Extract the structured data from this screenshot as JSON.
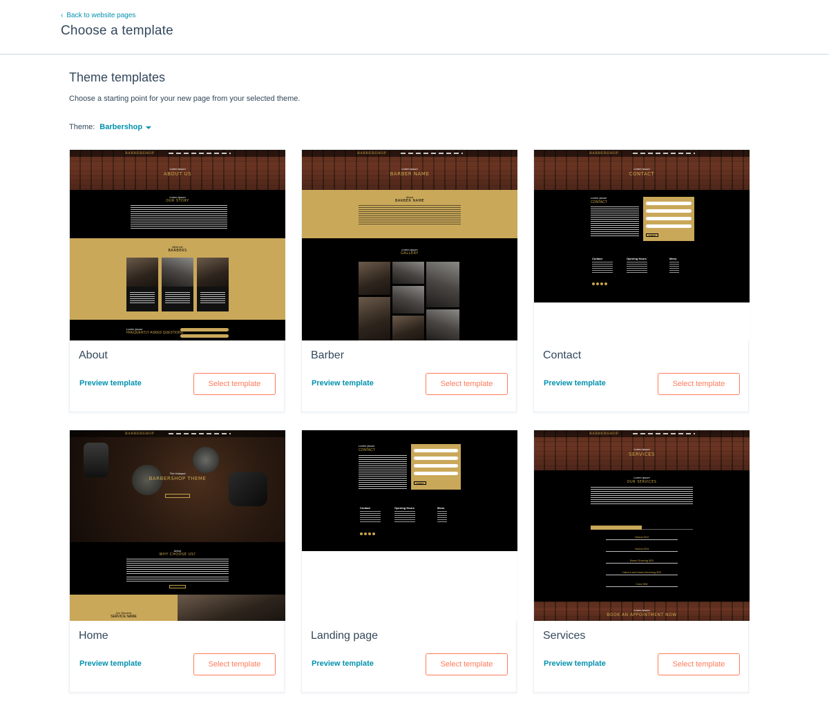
{
  "header": {
    "back_label": "Back to website pages",
    "title": "Choose a template"
  },
  "main": {
    "section_title": "Theme templates",
    "section_desc": "Choose a starting point for your new page from your selected theme.",
    "theme_label": "Theme:",
    "theme_value": "Barbershop"
  },
  "templates": [
    {
      "name": "About",
      "preview_label": "Preview template",
      "select_label": "Select template"
    },
    {
      "name": "Barber",
      "preview_label": "Preview template",
      "select_label": "Select template"
    },
    {
      "name": "Contact",
      "preview_label": "Preview template",
      "select_label": "Select template"
    },
    {
      "name": "Home",
      "preview_label": "Preview template",
      "select_label": "Select template"
    },
    {
      "name": "Landing page",
      "preview_label": "Preview template",
      "select_label": "Select template"
    },
    {
      "name": "Services",
      "preview_label": "Preview template",
      "select_label": "Select template"
    }
  ],
  "thumbs": {
    "logo": "BARBERSHOP",
    "about": {
      "hero": "ABOUT US",
      "story": "OUR STORY",
      "barbers": "BARBERS",
      "faq": "FREQUENTLY ASKED QUESTIONS",
      "kicker": "Lorem Ipsum",
      "kicker2": "Meet the"
    },
    "barber": {
      "hero": "BARBER NAME",
      "about": "BARBER NAME",
      "gallery": "GALLERY",
      "kicker": "Lorem Ipsum",
      "kicker2": "About"
    },
    "contact": {
      "hero": "CONTACT",
      "contact": "CONTACT",
      "kicker": "Lorem Ipsum",
      "col1": "Contact",
      "col2": "Opening Hours",
      "col3": "Menu",
      "submit": "SUBMIT"
    },
    "home": {
      "kicker": "The Hubspot",
      "hero": "BARBERSHOP THEME",
      "why": "WHY CHOOSE US?",
      "why_kicker": "About",
      "service": "SERVICE NAME",
      "service_kicker": "Our Services"
    },
    "landing": {
      "contact": "CONTACT",
      "kicker": "Lorem Ipsum",
      "col1": "Contact",
      "col2": "Opening Hours",
      "col3": "Menu",
      "submit": "SUBMIT"
    },
    "services": {
      "hero": "SERVICES",
      "our": "OUR SERVICES",
      "kicker": "Lorem Ipsum",
      "book": "BOOK AN APPOINTMENT NOW",
      "items": [
        "Haircut $10",
        "Haircut $15",
        "Beard Shaving $20",
        "Haircut and beard trimming $25",
        "Color $30"
      ]
    }
  },
  "colors": {
    "link": "#0091ae",
    "accent": "#ff7a59",
    "text": "#33475b",
    "gold": "#c9a85a"
  }
}
